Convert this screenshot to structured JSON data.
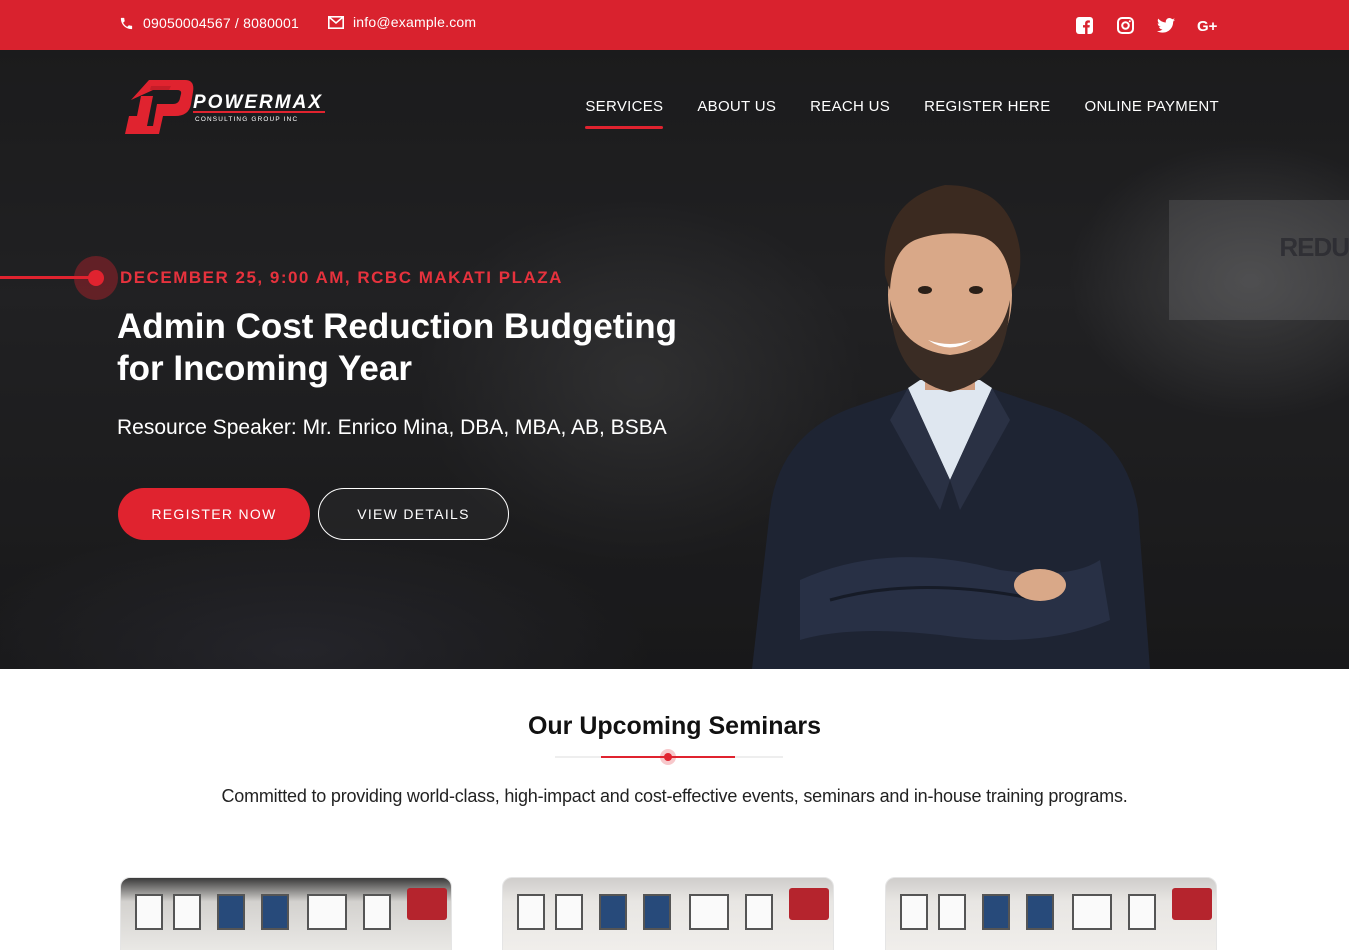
{
  "topbar": {
    "phone": "09050004567 / 8080001",
    "email": "info@example.com",
    "phone_icon": "phone-icon",
    "email_icon": "envelope-icon",
    "social": [
      "facebook-icon",
      "instagram-icon",
      "twitter-icon",
      "google-plus-icon"
    ]
  },
  "brand": {
    "name": "POWERMAX",
    "tagline": "CONSULTING GROUP INC"
  },
  "nav": {
    "items": [
      "SERVICES",
      "ABOUT US",
      "REACH US",
      "REGISTER HERE",
      "ONLINE PAYMENT"
    ],
    "active": "SERVICES"
  },
  "hero": {
    "date": "DECEMBER 25, 9:00 AM, RCBC MAKATI PLAZA",
    "title": "Admin Cost Reduction Budgeting for Incoming Year",
    "speaker": "Resource Speaker: Mr. Enrico Mina, DBA, MBA, AB, BSBA",
    "register_label": "REGISTER NOW",
    "details_label": "VIEW DETAILS",
    "background_text": "REDU"
  },
  "seminars": {
    "title": "Our Upcoming Seminars",
    "subtitle": "Committed to providing world-class, high-impact and cost-effective events, seminars and in-house training programs."
  },
  "colors": {
    "brand_red": "#d9222e",
    "accent_red": "#e0232f",
    "date_red": "#e6323d"
  }
}
